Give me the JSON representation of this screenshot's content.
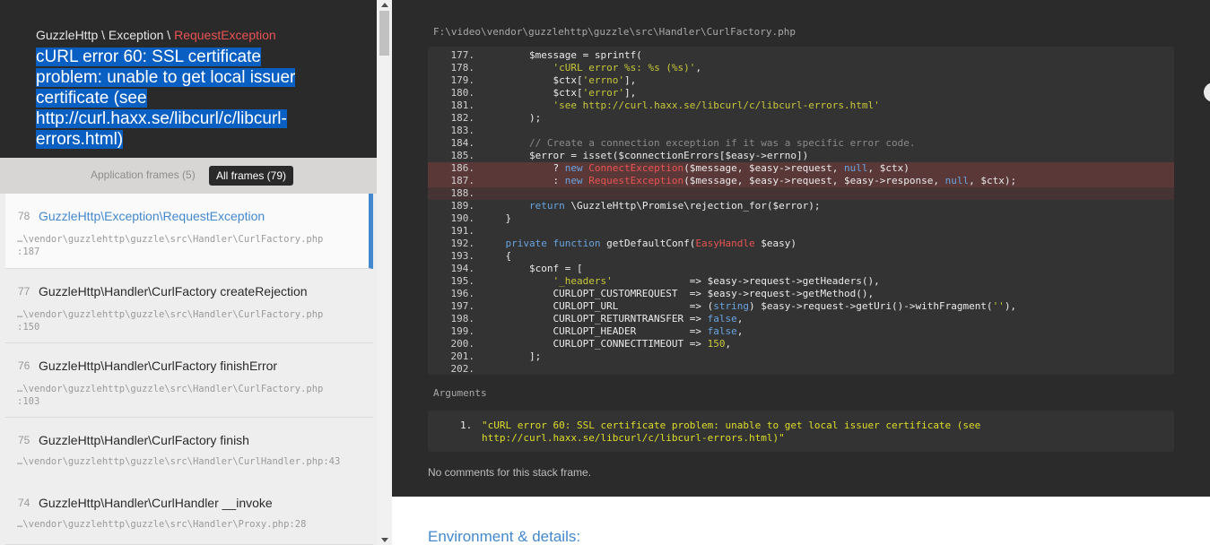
{
  "exception": {
    "namespace": "GuzzleHttp \\ Exception \\ ",
    "class": "RequestException",
    "message": "cURL error 60: SSL certificate problem: unable to get local issuer certificate (see http://curl.haxx.se/libcurl/c/libcurl-errors.html)"
  },
  "filters": {
    "app_frames": "Application frames (5)",
    "all_frames": "All frames (79)"
  },
  "frames": [
    {
      "num": "78",
      "cls": "GuzzleHttp\\Exception\\RequestException",
      "file": "…\\vendor\\guzzlehttp\\guzzle\\src\\Handler\\CurlFactory.php",
      "line": ":187"
    },
    {
      "num": "77",
      "cls": "GuzzleHttp\\Handler\\CurlFactory createRejection",
      "file": "…\\vendor\\guzzlehttp\\guzzle\\src\\Handler\\CurlFactory.php",
      "line": ":150"
    },
    {
      "num": "76",
      "cls": "GuzzleHttp\\Handler\\CurlFactory finishError",
      "file": "…\\vendor\\guzzlehttp\\guzzle\\src\\Handler\\CurlFactory.php",
      "line": ":103"
    },
    {
      "num": "75",
      "cls": "GuzzleHttp\\Handler\\CurlFactory finish",
      "file": "…\\vendor\\guzzlehttp\\guzzle\\src\\Handler\\CurlHandler.php:43",
      "line": ""
    },
    {
      "num": "74",
      "cls": "GuzzleHttp\\Handler\\CurlHandler __invoke",
      "file": "…\\vendor\\guzzlehttp\\guzzle\\src\\Handler\\Proxy.php:28",
      "line": ""
    }
  ],
  "code": {
    "file_path": "F:\\video\\vendor\\guzzlehttp\\guzzle\\src\\Handler\\CurlFactory.php",
    "lines": [
      {
        "n": "177.",
        "t": "        $message = sprintf("
      },
      {
        "n": "178.",
        "t": "            'cURL error %s: %s (%s)',"
      },
      {
        "n": "179.",
        "t": "            $ctx['errno'],"
      },
      {
        "n": "180.",
        "t": "            $ctx['error'],"
      },
      {
        "n": "181.",
        "t": "            'see http://curl.haxx.se/libcurl/c/libcurl-errors.html'"
      },
      {
        "n": "182.",
        "t": "        );"
      },
      {
        "n": "183.",
        "t": ""
      },
      {
        "n": "184.",
        "t": "        // Create a connection exception if it was a specific error code."
      },
      {
        "n": "185.",
        "t": "        $error = isset($connectionErrors[$easy->errno])"
      },
      {
        "n": "186.",
        "t": "            ? new ConnectException($message, $easy->request, null, $ctx)"
      },
      {
        "n": "187.",
        "t": "            : new RequestException($message, $easy->request, $easy->response, null, $ctx);"
      },
      {
        "n": "188.",
        "t": ""
      },
      {
        "n": "189.",
        "t": "        return \\GuzzleHttp\\Promise\\rejection_for($error);"
      },
      {
        "n": "190.",
        "t": "    }"
      },
      {
        "n": "191.",
        "t": ""
      },
      {
        "n": "192.",
        "t": "    private function getDefaultConf(EasyHandle $easy)"
      },
      {
        "n": "193.",
        "t": "    {"
      },
      {
        "n": "194.",
        "t": "        $conf = ["
      },
      {
        "n": "195.",
        "t": "            '_headers'             => $easy->request->getHeaders(),"
      },
      {
        "n": "196.",
        "t": "            CURLOPT_CUSTOMREQUEST  => $easy->request->getMethod(),"
      },
      {
        "n": "197.",
        "t": "            CURLOPT_URL            => (string) $easy->request->getUri()->withFragment(''),"
      },
      {
        "n": "198.",
        "t": "            CURLOPT_RETURNTRANSFER => false,"
      },
      {
        "n": "199.",
        "t": "            CURLOPT_HEADER         => false,"
      },
      {
        "n": "200.",
        "t": "            CURLOPT_CONNECTTIMEOUT => 150,"
      },
      {
        "n": "201.",
        "t": "        ];"
      },
      {
        "n": "202.",
        "t": ""
      }
    ]
  },
  "arguments": {
    "title": "Arguments",
    "num": "1.",
    "value": "\"cURL error 60: SSL certificate problem: unable to get local issuer certificate (see http://curl.haxx.se/libcurl/c/libcurl-errors.html)\""
  },
  "no_comments": "No comments for this stack frame.",
  "environment_title": "Environment & details:",
  "colors": {
    "accent": "#4288ce",
    "error": "#e95353",
    "dark": "#2a2a2a"
  }
}
